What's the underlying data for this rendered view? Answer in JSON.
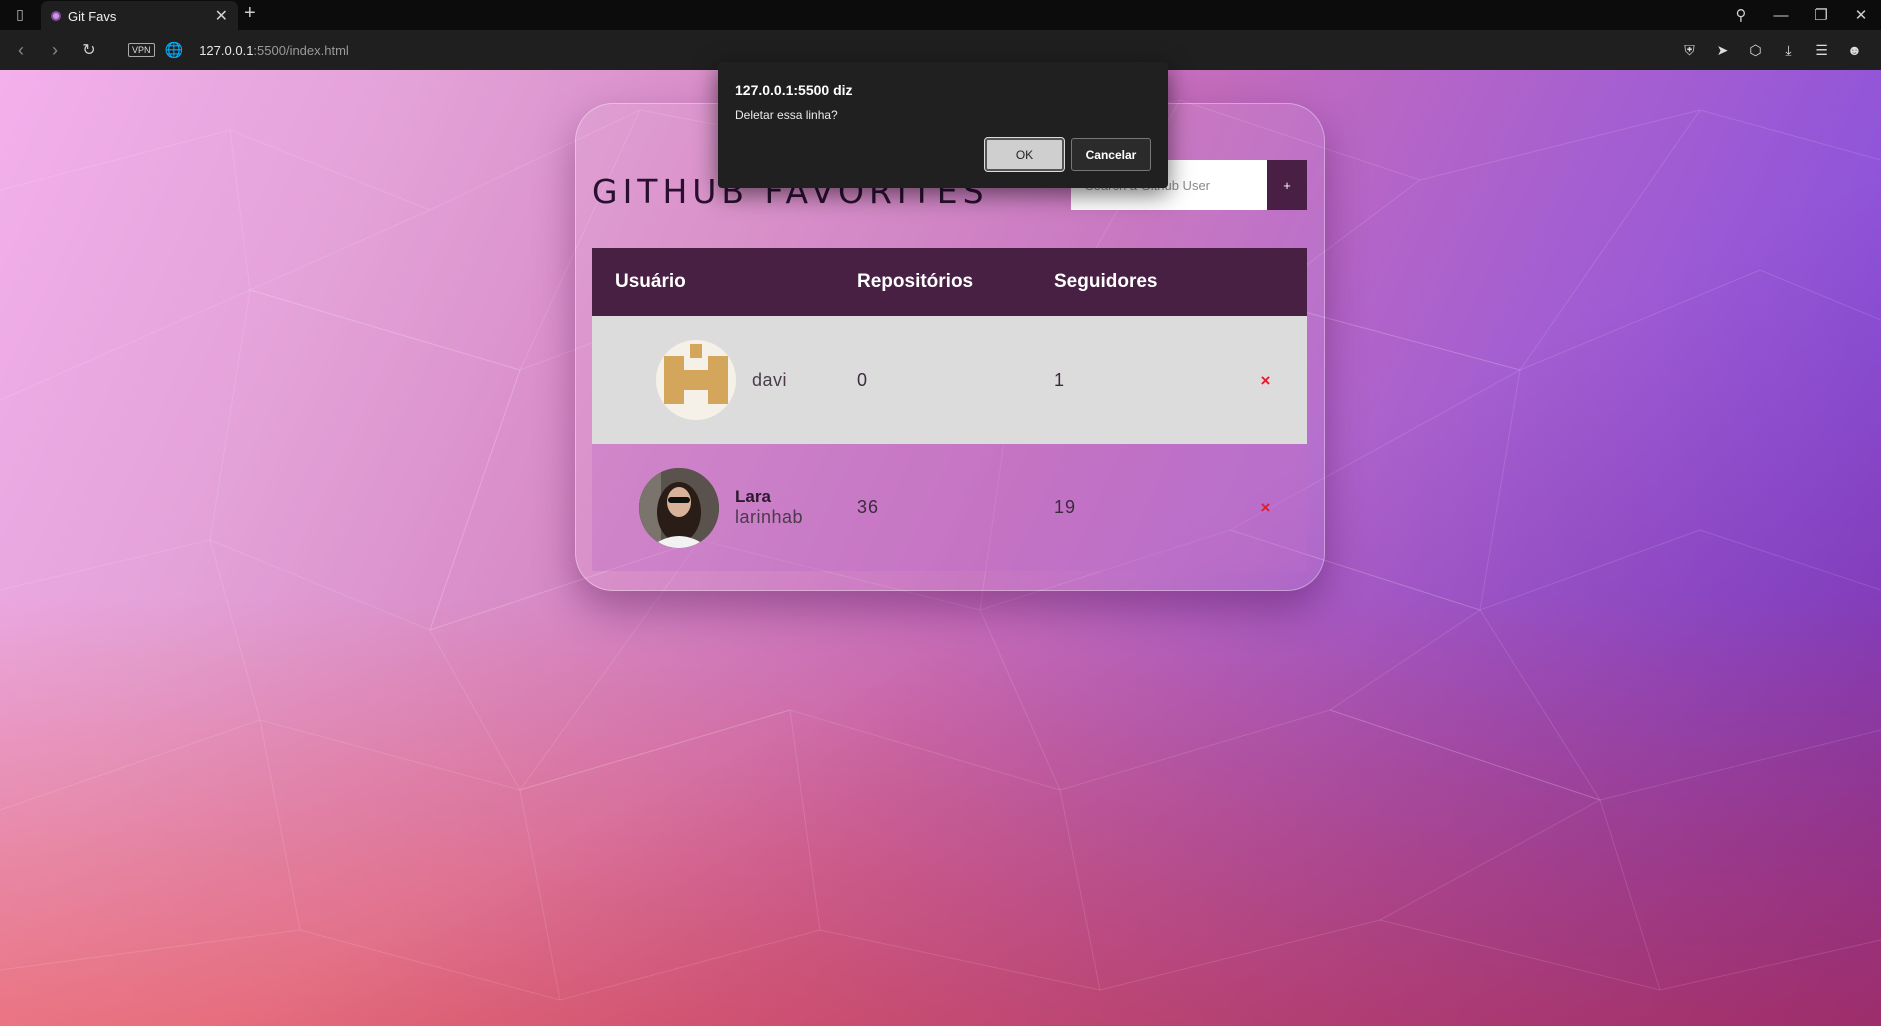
{
  "browser": {
    "tab_title": "Git Favs",
    "url_host": "127.0.0.1",
    "url_rest": ":5500/index.html",
    "vpn_label": "VPN"
  },
  "app": {
    "title": "GITHUB FAVORITES",
    "search_placeholder": "Search a Github User",
    "add_label": "+"
  },
  "table": {
    "headers": [
      "Usuário",
      "Repositórios",
      "Seguidores"
    ],
    "rows": [
      {
        "name": "",
        "login": "davi",
        "repos": "0",
        "followers": "1",
        "remove": "×"
      },
      {
        "name": "Lara",
        "login": "larinhab",
        "repos": "36",
        "followers": "19",
        "remove": "×"
      }
    ]
  },
  "dialog": {
    "title": "127.0.0.1:5500 diz",
    "message": "Deletar essa linha?",
    "ok_label": "OK",
    "cancel_label": "Cancelar"
  },
  "colors": {
    "table_header": "#472043",
    "add_button": "#4a1f45",
    "remove_icon": "#e21d2c",
    "identicon": "#d4a65c"
  }
}
